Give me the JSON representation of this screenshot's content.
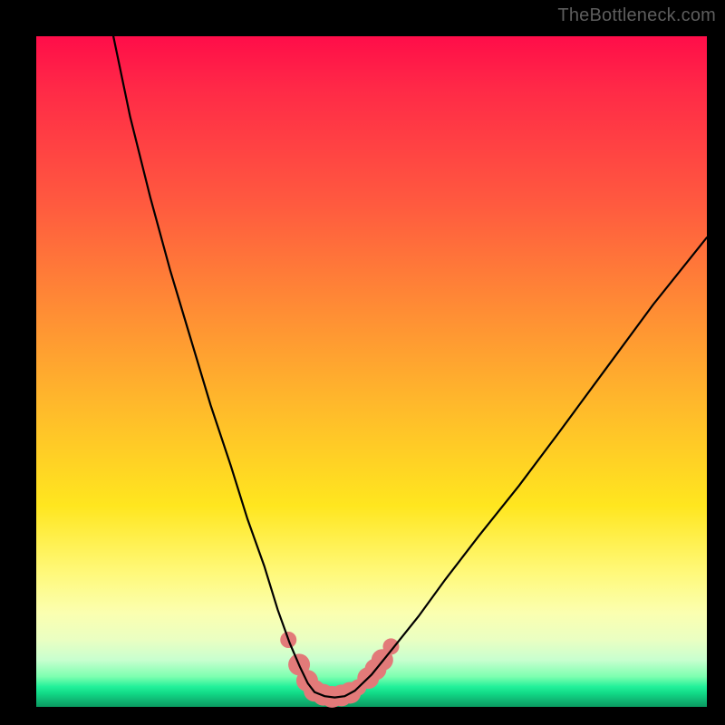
{
  "watermark": "TheBottleneck.com",
  "colors": {
    "page_bg": "#000000",
    "gradient_top": "#ff0d49",
    "gradient_mid": "#ffe61f",
    "gradient_bottom": "#0a9a60",
    "curve": "#000000",
    "markers": "#e27a79"
  },
  "chart_data": {
    "type": "line",
    "title": "",
    "xlabel": "",
    "ylabel": "",
    "xlim": [
      0,
      100
    ],
    "ylim": [
      0,
      100
    ],
    "grid": false,
    "legend": false,
    "note": "Values estimated from pixel positions; no numeric axes are shown in the image.",
    "series": [
      {
        "name": "left-branch",
        "x": [
          11.5,
          14,
          17,
          20,
          23,
          26,
          29,
          31.5,
          34,
          36,
          37.8,
          39.3,
          40.5,
          41.5
        ],
        "y": [
          100,
          88,
          76,
          65,
          55,
          45,
          36,
          28,
          21,
          14.5,
          9.5,
          6,
          3.5,
          2.2
        ]
      },
      {
        "name": "valley-floor",
        "x": [
          41.5,
          43,
          44.5,
          46,
          47.5
        ],
        "y": [
          2.2,
          1.6,
          1.4,
          1.6,
          2.4
        ]
      },
      {
        "name": "right-branch",
        "x": [
          47.5,
          50,
          53,
          57,
          61,
          66,
          72,
          78,
          85,
          92,
          100
        ],
        "y": [
          2.4,
          4.8,
          8.5,
          13.5,
          19,
          25.5,
          33,
          41,
          50.5,
          60,
          70
        ]
      }
    ],
    "markers": {
      "name": "highlight-points",
      "color": "#e27a79",
      "radius_big": 12,
      "radius_small": 9,
      "points": [
        {
          "x": 37.6,
          "y": 10.0,
          "r": 9
        },
        {
          "x": 39.2,
          "y": 6.3,
          "r": 12
        },
        {
          "x": 40.4,
          "y": 3.9,
          "r": 12
        },
        {
          "x": 41.5,
          "y": 2.4,
          "r": 12
        },
        {
          "x": 42.8,
          "y": 1.8,
          "r": 12
        },
        {
          "x": 44.1,
          "y": 1.5,
          "r": 12
        },
        {
          "x": 45.5,
          "y": 1.7,
          "r": 12
        },
        {
          "x": 46.8,
          "y": 2.1,
          "r": 12
        },
        {
          "x": 48.0,
          "y": 2.9,
          "r": 9
        },
        {
          "x": 49.5,
          "y": 4.3,
          "r": 12
        },
        {
          "x": 50.6,
          "y": 5.6,
          "r": 12
        },
        {
          "x": 51.6,
          "y": 7.0,
          "r": 12
        },
        {
          "x": 52.9,
          "y": 9.0,
          "r": 9
        }
      ]
    }
  }
}
